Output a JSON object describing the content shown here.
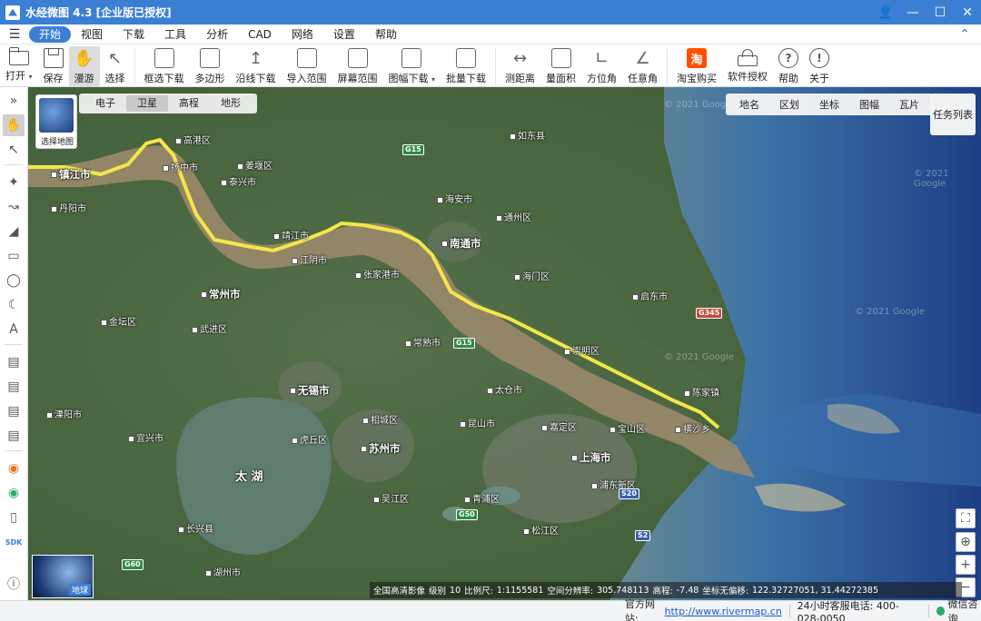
{
  "titlebar": {
    "title": "水经微图 4.3 [企业版已授权]"
  },
  "menu": {
    "items": [
      "开始",
      "视图",
      "下载",
      "工具",
      "分析",
      "CAD",
      "网络",
      "设置",
      "帮助"
    ]
  },
  "toolbar": {
    "open": "打开",
    "save": "保存",
    "pan": "漫游",
    "select": "选择",
    "box_download": "框选下载",
    "polygon": "多边形",
    "along_line": "沿线下载",
    "import_range": "导入范围",
    "screen_range": "屏幕范围",
    "sheet_download": "图幅下载",
    "batch_download": "批量下载",
    "measure_distance": "测距离",
    "measure_area": "量面积",
    "azimuth": "方位角",
    "any_angle": "任意角",
    "taobao": "淘宝购买",
    "license": "软件授权",
    "help": "帮助",
    "about": "关于",
    "taobao_glyph": "淘"
  },
  "map": {
    "layer_thumb_label": "选择地图",
    "layer_tabs": [
      "电子",
      "卫星",
      "高程",
      "地形"
    ],
    "active_layer": "卫星",
    "top_tabs": [
      "地名",
      "区划",
      "坐标",
      "图幅",
      "瓦片"
    ],
    "task_list": "任务列表",
    "globe_label": "地球",
    "watermarks": [
      "© 2021 Google",
      "© 2021 Google",
      "© 2021 Google",
      "© 2021 Google"
    ],
    "labels": [
      {
        "t": "镇江市",
        "cls": "city"
      },
      {
        "t": "扬中市",
        "cls": ""
      },
      {
        "t": "高港区",
        "cls": ""
      },
      {
        "t": "泰兴市",
        "cls": ""
      },
      {
        "t": "靖江市",
        "cls": ""
      },
      {
        "t": "南通市",
        "cls": "city"
      },
      {
        "t": "如东县",
        "cls": ""
      },
      {
        "t": "海门区",
        "cls": ""
      },
      {
        "t": "启东市",
        "cls": ""
      },
      {
        "t": "常州市",
        "cls": "city"
      },
      {
        "t": "江阴市",
        "cls": ""
      },
      {
        "t": "张家港市",
        "cls": ""
      },
      {
        "t": "常熟市",
        "cls": ""
      },
      {
        "t": "崇明区",
        "cls": ""
      },
      {
        "t": "无锡市",
        "cls": "city"
      },
      {
        "t": "苏州市",
        "cls": "city"
      },
      {
        "t": "上海市",
        "cls": "city"
      },
      {
        "t": "宝山区",
        "cls": ""
      },
      {
        "t": "昆山市",
        "cls": ""
      },
      {
        "t": "太仓市",
        "cls": ""
      },
      {
        "t": "嘉定区",
        "cls": ""
      },
      {
        "t": "溧阳市",
        "cls": ""
      },
      {
        "t": "宜兴市",
        "cls": ""
      },
      {
        "t": "湖州市",
        "cls": ""
      },
      {
        "t": "吴江区",
        "cls": ""
      },
      {
        "t": "青浦区",
        "cls": ""
      },
      {
        "t": "松江区",
        "cls": ""
      },
      {
        "t": "丹阳市",
        "cls": ""
      },
      {
        "t": "金坛区",
        "cls": ""
      },
      {
        "t": "武进区",
        "cls": ""
      },
      {
        "t": "海安市",
        "cls": ""
      },
      {
        "t": "通州区",
        "cls": ""
      },
      {
        "t": "长兴县",
        "cls": ""
      },
      {
        "t": "太 湖",
        "cls": "lake"
      },
      {
        "t": "浦东新区",
        "cls": ""
      },
      {
        "t": "相城区",
        "cls": ""
      },
      {
        "t": "虎丘区",
        "cls": ""
      },
      {
        "t": "姜堰区",
        "cls": ""
      },
      {
        "t": "横沙乡",
        "cls": ""
      },
      {
        "t": "陈家镇",
        "cls": ""
      }
    ],
    "shields": [
      {
        "t": "G15",
        "cls": ""
      },
      {
        "t": "G15",
        "cls": ""
      },
      {
        "t": "G50",
        "cls": ""
      },
      {
        "t": "G60",
        "cls": ""
      },
      {
        "t": "S20",
        "cls": "blue"
      },
      {
        "t": "S2",
        "cls": "blue"
      },
      {
        "t": "G345",
        "cls": "red"
      }
    ],
    "info": {
      "source": "全国高清影像",
      "level_label": "级别",
      "level": "10",
      "scale_label": "比例尺:",
      "scale": "1:1155581",
      "resolution_label": "空间分辨率:",
      "resolution": "305.748113",
      "elevation_label": "高程:",
      "elevation": "-7.48",
      "coord_label": "坐标无偏移:",
      "coords": "122.32727051, 31.44272385"
    }
  },
  "statusbar": {
    "site_label": "官方网站:",
    "site_url": "http://www.rivermap.cn",
    "hotline": "24小时客服电话: 400-028-0050",
    "wechat": "微信咨询"
  }
}
